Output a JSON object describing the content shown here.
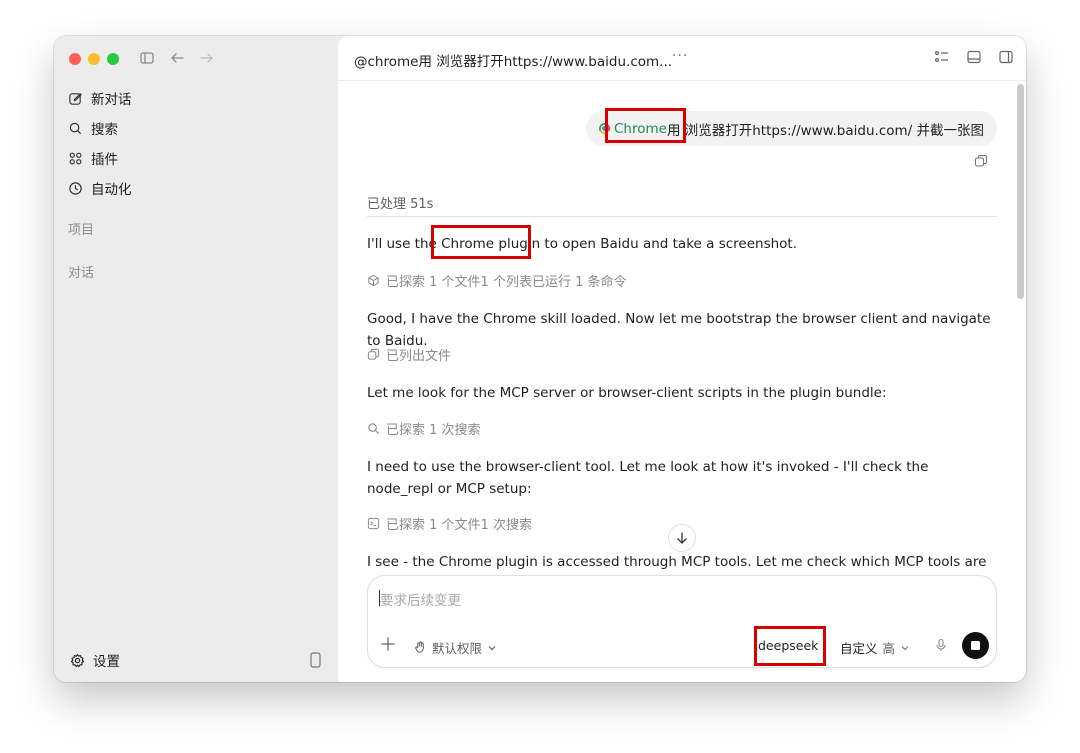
{
  "sidebar": {
    "nav": [
      {
        "label": "新对话",
        "icon": "edit-icon"
      },
      {
        "label": "搜索",
        "icon": "search-icon"
      },
      {
        "label": "插件",
        "icon": "plugins-icon"
      },
      {
        "label": "自动化",
        "icon": "clock-icon"
      }
    ],
    "section_projects": "项目",
    "section_chats": "对话",
    "settings_label": "设置"
  },
  "titlebar": {
    "title": "@chrome用 浏览器打开https://www.baidu.com...",
    "more": "···"
  },
  "conversation": {
    "user_message": {
      "chip_label": "Chrome",
      "text": "用 浏览器打开https://www.baidu.com/ 并截一张图"
    },
    "processed_label": "已处理 51s",
    "items": [
      {
        "kind": "text",
        "text_before": "I'll use the ",
        "highlight": "Chrome plugin",
        "text_after": " to open Baidu and take a screenshot."
      },
      {
        "kind": "activity",
        "icon": "cube-icon",
        "text": "已探索 1 个文件1 个列表已运行 1 条命令"
      },
      {
        "kind": "text",
        "text": "Good, I have the Chrome skill loaded. Now let me bootstrap the browser client and navigate to Baidu."
      },
      {
        "kind": "activity",
        "icon": "copy-icon",
        "text": "已列出文件"
      },
      {
        "kind": "text",
        "text": "Let me look for the MCP server or browser-client scripts in the plugin bundle:"
      },
      {
        "kind": "activity",
        "icon": "search-icon",
        "text": "已探索 1 次搜索"
      },
      {
        "kind": "text",
        "text": "I need to use the browser-client tool. Let me look at how it's invoked - I'll check the node_repl or MCP setup:"
      },
      {
        "kind": "activity",
        "icon": "terminal-icon",
        "text": "已探索 1 个文件1 次搜索"
      },
      {
        "kind": "text",
        "text": "I see - the Chrome plugin is accessed through MCP tools. Let me check which MCP tools are"
      }
    ]
  },
  "composer": {
    "placeholder": "要求后续变更",
    "permission_label": "默认权限",
    "model": "deepseek",
    "effort_label": "自定义",
    "effort_level": "高"
  },
  "colors": {
    "highlight_box": "#d60000",
    "chrome_text": "#1b8a5a",
    "sidebar_bg": "#ececec"
  }
}
